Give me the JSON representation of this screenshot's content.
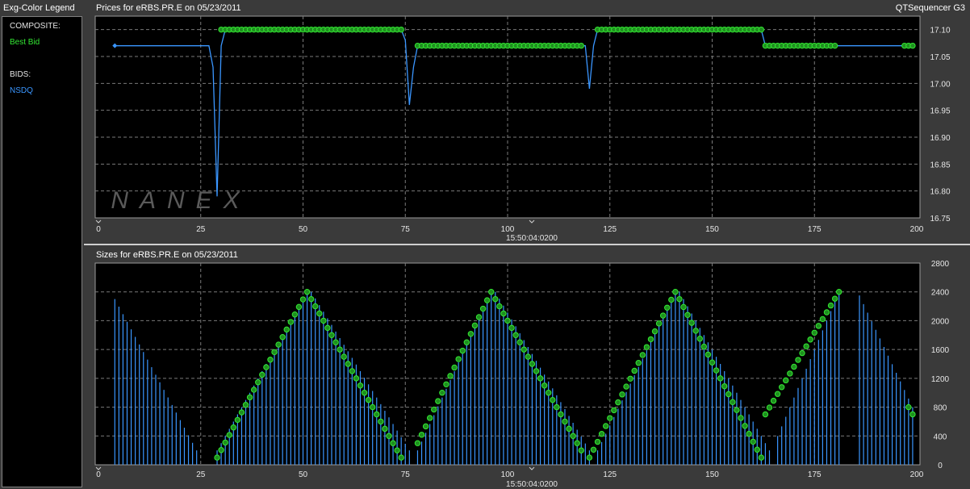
{
  "legend": {
    "header": "Exg-Color Legend",
    "composite_label": "COMPOSITE:",
    "composite_item": "Best Bid",
    "composite_color": "#33e833",
    "bids_label": "BIDS:",
    "bids_item": "NSDQ",
    "bids_color": "#3a96ff"
  },
  "app_name": "QTSequencer G3",
  "watermark": "NANEX",
  "chart_data": [
    {
      "type": "line",
      "title": "Prices for  eRBS.PR.E  on  05/23/2011",
      "time_label": "15:50:04:0200",
      "xlim": [
        0,
        200
      ],
      "xticks": [
        0,
        25,
        50,
        75,
        100,
        125,
        150,
        175,
        200
      ],
      "ylim": [
        16.75,
        17.125
      ],
      "yticks": [
        16.75,
        16.8,
        16.85,
        16.9,
        16.95,
        17.0,
        17.05,
        17.1
      ],
      "ytick_labels": [
        "16.75",
        "16.80",
        "16.85",
        "16.90",
        "16.95",
        "17.00",
        "17.05",
        "17.10"
      ],
      "series": [
        {
          "name": "NSDQ",
          "color": "#3a96ff",
          "points": [
            [
              4,
              17.07
            ],
            [
              27,
              17.07
            ],
            [
              28,
              17.03
            ],
            [
              29,
              16.79
            ],
            [
              30,
              17.07
            ],
            [
              31,
              17.1
            ],
            [
              74,
              17.1
            ],
            [
              75,
              17.08
            ],
            [
              76,
              16.96
            ],
            [
              77,
              17.03
            ],
            [
              78,
              17.07
            ],
            [
              119,
              17.07
            ],
            [
              120,
              16.99
            ],
            [
              121,
              17.07
            ],
            [
              122,
              17.1
            ],
            [
              162,
              17.1
            ],
            [
              163,
              17.07
            ],
            [
              197,
              17.07
            ],
            [
              199,
              17.07
            ]
          ]
        },
        {
          "name": "Best Bid",
          "color": "#33e833",
          "marker_segments": [
            {
              "from": 30,
              "to": 74,
              "y": 17.1
            },
            {
              "from": 78,
              "to": 118,
              "y": 17.07
            },
            {
              "from": 122,
              "to": 162,
              "y": 17.1
            },
            {
              "from": 163,
              "to": 180,
              "y": 17.07
            },
            {
              "from": 197,
              "to": 199,
              "y": 17.07
            }
          ]
        }
      ]
    },
    {
      "type": "bar",
      "title": "Sizes for  eRBS.PR.E  on  05/23/2011",
      "time_label": "15:50:04:0200",
      "xlim": [
        0,
        200
      ],
      "xticks": [
        0,
        25,
        50,
        75,
        100,
        125,
        150,
        175,
        200
      ],
      "ylim": [
        0,
        2800
      ],
      "yticks": [
        0,
        400,
        800,
        1200,
        1600,
        2000,
        2400,
        2800
      ],
      "ytick_labels": [
        "0",
        "400",
        "800",
        "1200",
        "1600",
        "2000",
        "2400",
        "2800"
      ],
      "series": [
        {
          "name": "NSDQ",
          "color": "#3a96ff",
          "bars_down": [
            {
              "from": 4,
              "to": 24,
              "start": 2300,
              "end": 200
            },
            {
              "from": 52,
              "to": 76,
              "start": 2400,
              "end": 200
            },
            {
              "from": 97,
              "to": 120,
              "start": 2400,
              "end": 200
            },
            {
              "from": 142,
              "to": 164,
              "start": 2400,
              "end": 200
            },
            {
              "from": 186,
              "to": 199,
              "start": 2350,
              "end": 800
            }
          ],
          "bars_up": [
            {
              "from": 29,
              "to": 51,
              "start": 200,
              "end": 2400
            },
            {
              "from": 78,
              "to": 96,
              "start": 200,
              "end": 2400
            },
            {
              "from": 122,
              "to": 141,
              "start": 200,
              "end": 2400
            },
            {
              "from": 166,
              "to": 181,
              "start": 400,
              "end": 2400
            }
          ]
        },
        {
          "name": "Best Bid",
          "color": "#33e833",
          "marker_segments": [
            {
              "from": 29,
              "to": 51,
              "start": 100,
              "end": 2400
            },
            {
              "from": 52,
              "to": 74,
              "start": 2300,
              "end": 100
            },
            {
              "from": 78,
              "to": 96,
              "start": 300,
              "end": 2400
            },
            {
              "from": 97,
              "to": 118,
              "start": 2300,
              "end": 200
            },
            {
              "from": 120,
              "to": 141,
              "start": 100,
              "end": 2400
            },
            {
              "from": 142,
              "to": 162,
              "start": 2300,
              "end": 100
            },
            {
              "from": 163,
              "to": 181,
              "start": 700,
              "end": 2400
            },
            {
              "from": 198,
              "to": 199,
              "start": 800,
              "end": 700
            }
          ]
        }
      ]
    }
  ]
}
